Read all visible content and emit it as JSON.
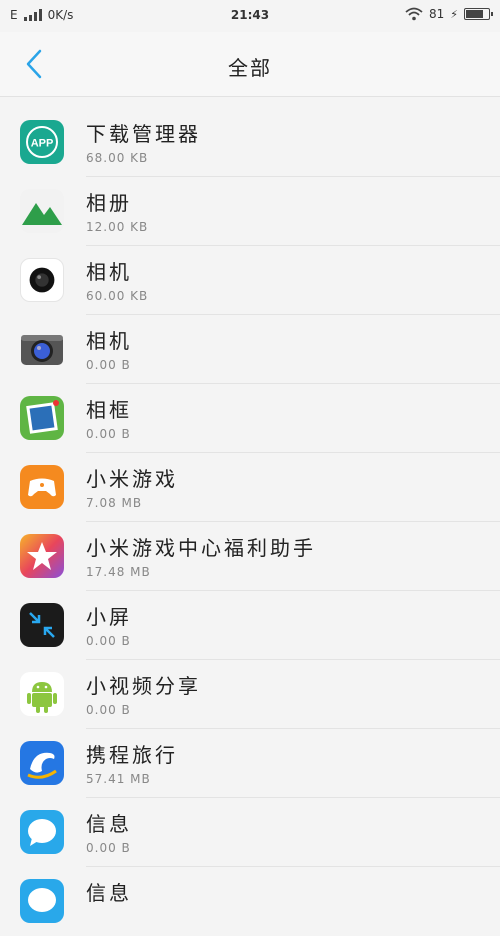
{
  "status_bar": {
    "network": "E",
    "speed": "0K/s",
    "time": "21:43",
    "battery_text": "81",
    "battery_level": 0.81
  },
  "header": {
    "title": "全部"
  },
  "apps": [
    {
      "name": "下载管理器",
      "size": "68.00 KB",
      "icon": "app-box-icon"
    },
    {
      "name": "相册",
      "size": "12.00 KB",
      "icon": "mountain-gallery-icon"
    },
    {
      "name": "相机",
      "size": "60.00 KB",
      "icon": "camera-lens-icon"
    },
    {
      "name": "相机",
      "size": "0.00 B",
      "icon": "camera-icon"
    },
    {
      "name": "相框",
      "size": "0.00 B",
      "icon": "photo-frame-icon"
    },
    {
      "name": "小米游戏",
      "size": "7.08 MB",
      "icon": "gamepad-icon"
    },
    {
      "name": "小米游戏中心福利助手",
      "size": "17.48 MB",
      "icon": "star-icon"
    },
    {
      "name": "小屏",
      "size": "0.00 B",
      "icon": "shrink-screen-icon"
    },
    {
      "name": "小视频分享",
      "size": "0.00 B",
      "icon": "android-icon"
    },
    {
      "name": "携程旅行",
      "size": "57.41 MB",
      "icon": "dolphin-icon"
    },
    {
      "name": "信息",
      "size": "0.00 B",
      "icon": "message-bubble-icon"
    },
    {
      "name": "信息",
      "size": "",
      "icon": "message-bubble-icon"
    }
  ]
}
